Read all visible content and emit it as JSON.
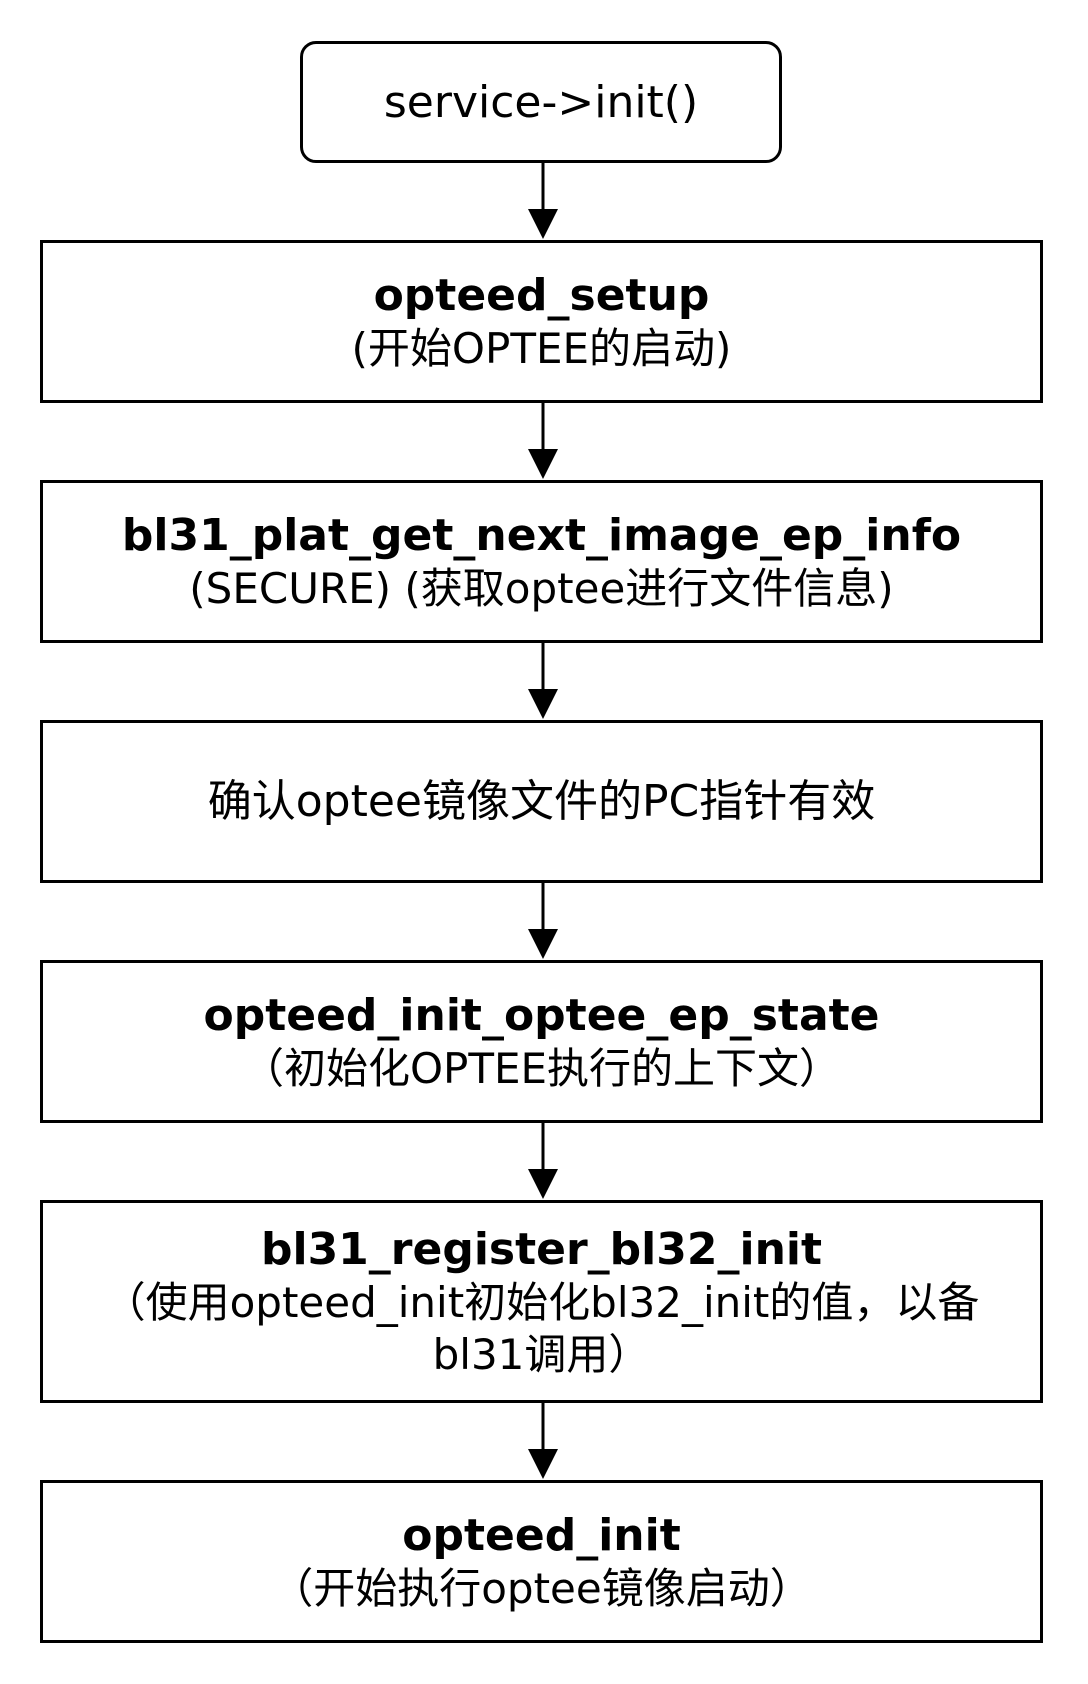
{
  "diagram": {
    "start": "service->init()",
    "steps": [
      {
        "title": "opteed_setup",
        "lines": [
          "(开始OPTEE的启动)"
        ]
      },
      {
        "title": "bl31_plat_get_next_image_ep_info",
        "lines": [
          "(SECURE) (获取optee进行文件信息)"
        ]
      },
      {
        "title": "",
        "lines": [
          "确认optee镜像文件的PC指针有效"
        ]
      },
      {
        "title": "opteed_init_optee_ep_state",
        "lines": [
          "（初始化OPTEE执行的上下文）"
        ]
      },
      {
        "title": "bl31_register_bl32_init",
        "lines": [
          "（使用opteed_init初始化bl32_init的值，以备",
          "bl31调用）"
        ]
      },
      {
        "title": "opteed_init",
        "lines": [
          "（开始执行optee镜像启动）"
        ]
      }
    ]
  }
}
